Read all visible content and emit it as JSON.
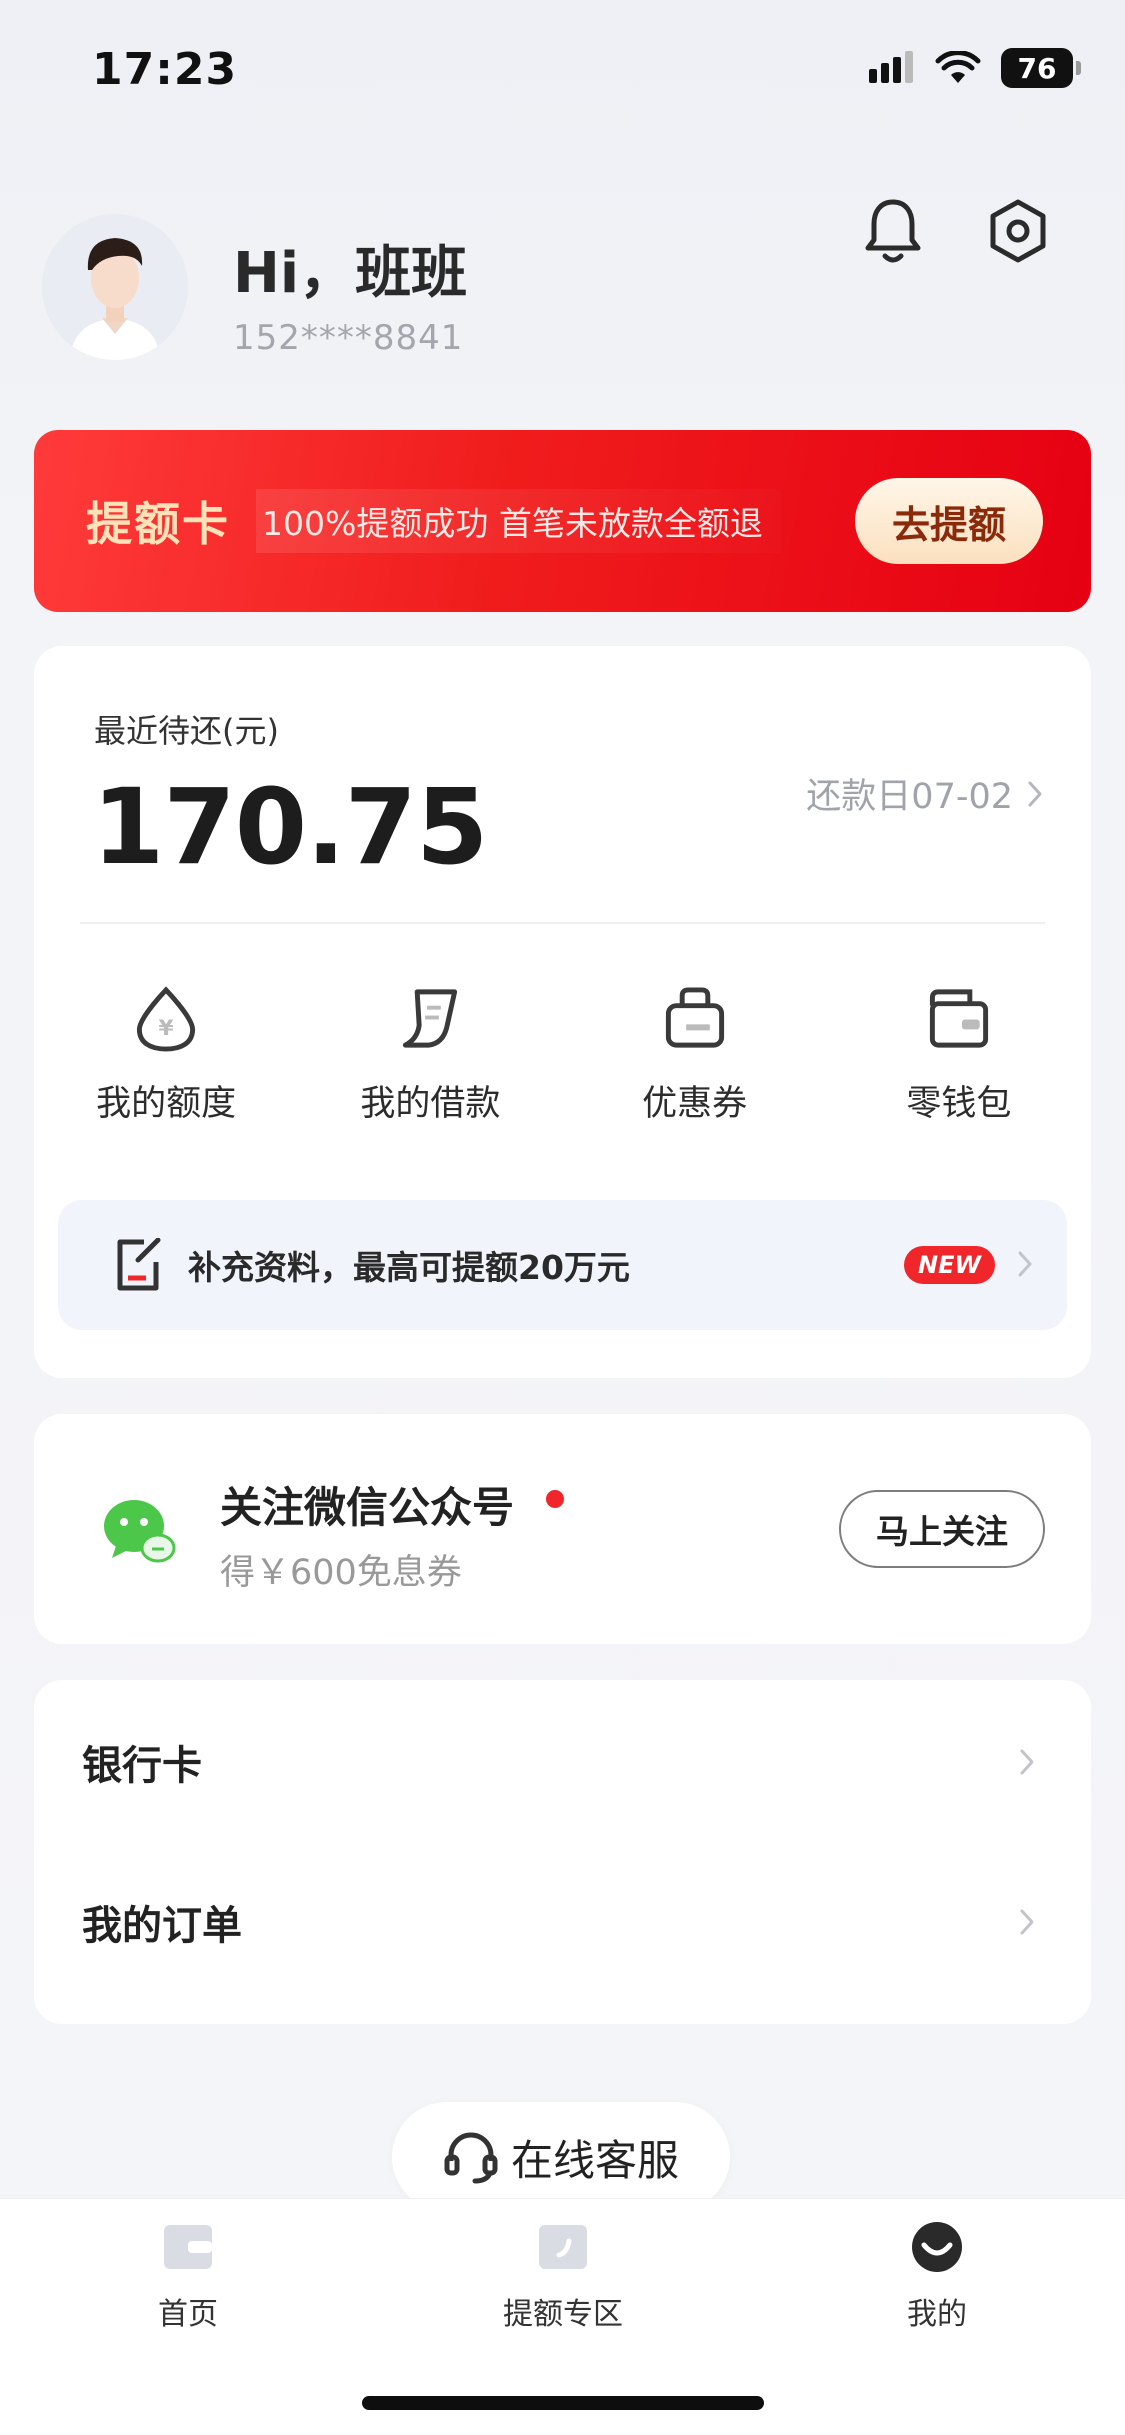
{
  "status_bar": {
    "time": "17:23",
    "battery": "76"
  },
  "profile": {
    "greeting": "Hi，班班",
    "phone": "152****8841"
  },
  "promo": {
    "title": "提额卡",
    "desc": "100%提额成功 首笔未放款全额退",
    "button": "去提额"
  },
  "repay": {
    "label": "最近待还(元)",
    "amount": "170.75",
    "due_date": "还款日07-02"
  },
  "quick_actions": [
    {
      "label": "我的额度",
      "icon": "drop-yen-icon"
    },
    {
      "label": "我的借款",
      "icon": "receipt-icon"
    },
    {
      "label": "优惠券",
      "icon": "coupon-bag-icon"
    },
    {
      "label": "零钱包",
      "icon": "wallet-icon"
    }
  ],
  "supplement": {
    "text": "补充资料，最高可提额20万元",
    "badge": "NEW"
  },
  "wechat": {
    "title": "关注微信公众号",
    "subtitle": "得￥600免息券",
    "button": "马上关注"
  },
  "menu": [
    {
      "label": "银行卡"
    },
    {
      "label": "我的订单"
    }
  ],
  "service": {
    "label": "在线客服"
  },
  "tabbar": [
    {
      "label": "首页",
      "icon": "home-wallet-icon"
    },
    {
      "label": "提额专区",
      "icon": "boost-icon"
    },
    {
      "label": "我的",
      "icon": "profile-smile-icon"
    }
  ],
  "colors": {
    "brand_red": "#e60012",
    "accent_gold": "#ffe2b8",
    "badge_red": "#f0262a"
  }
}
